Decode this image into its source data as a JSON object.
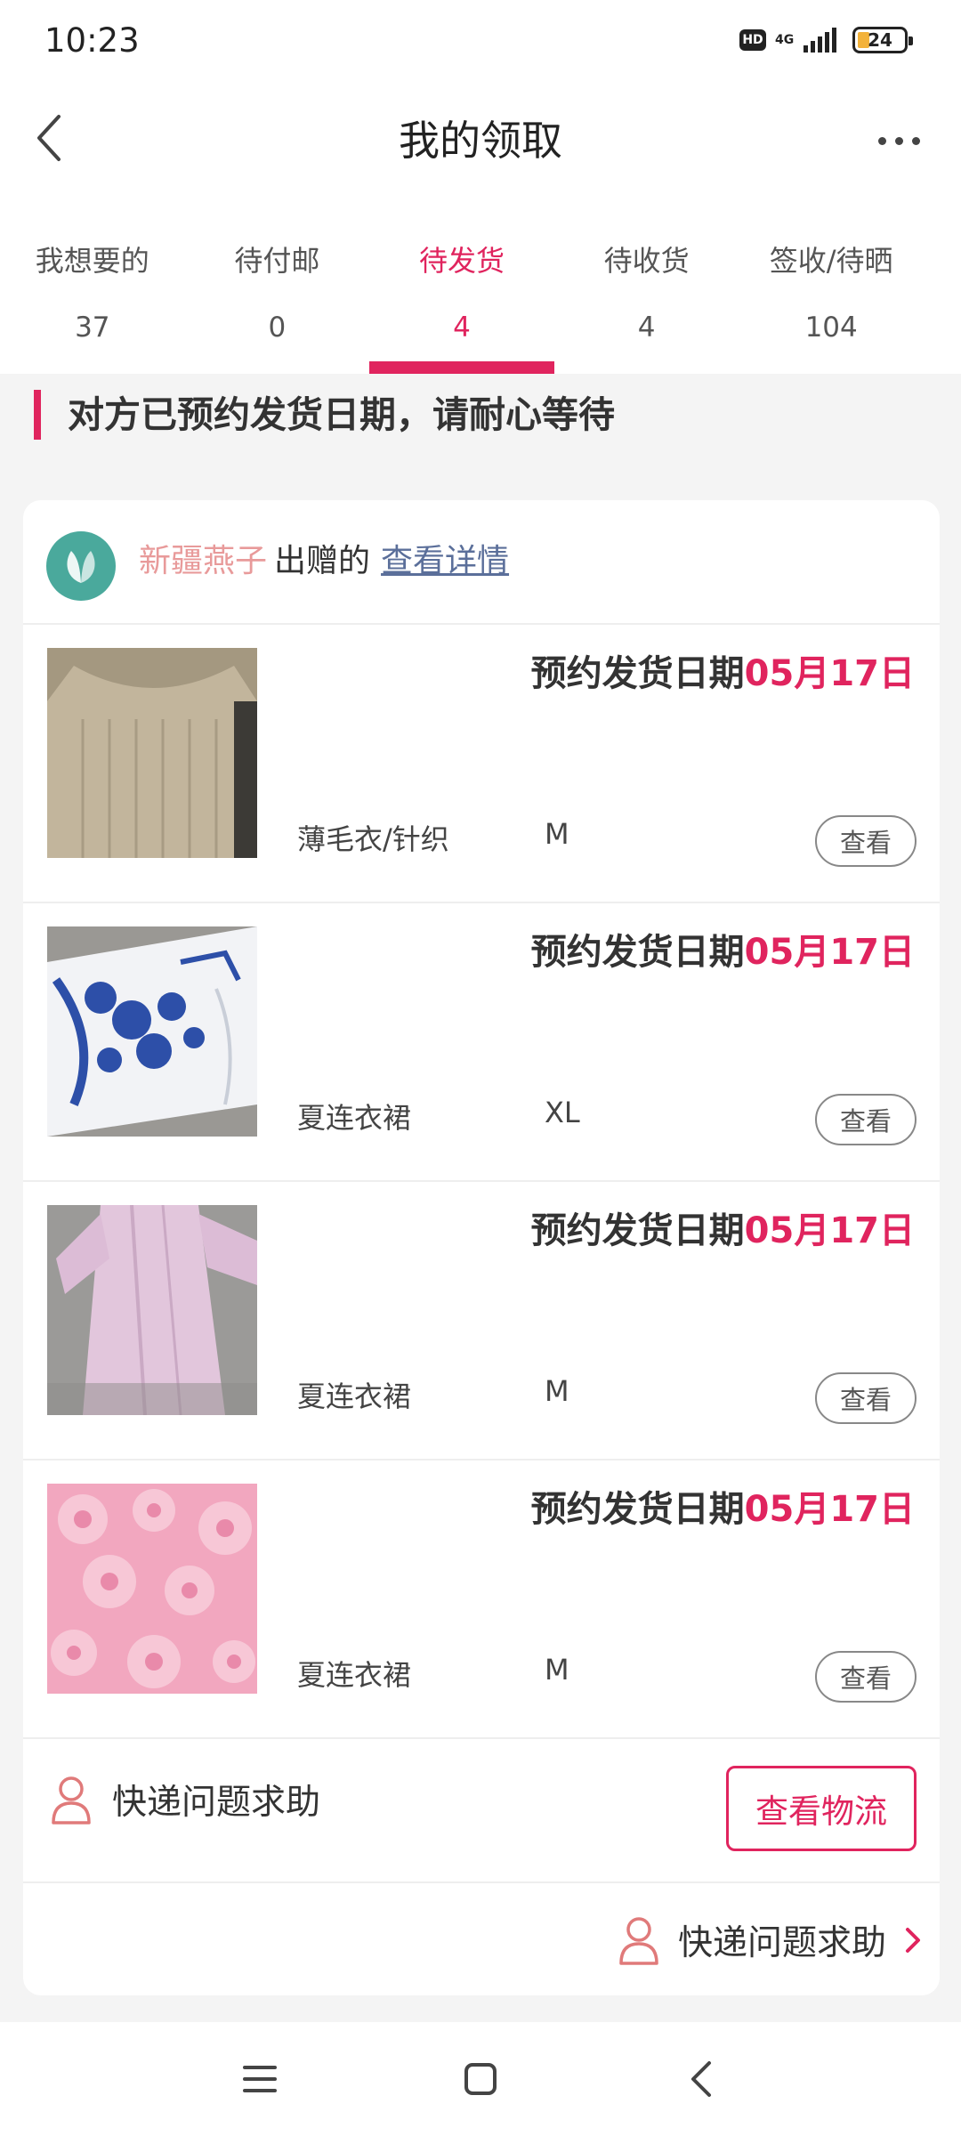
{
  "status_bar": {
    "time": "10:23",
    "hd": "HD",
    "network": "4G",
    "battery": "24"
  },
  "header": {
    "title": "我的领取"
  },
  "tabs": [
    {
      "label": "我想要的",
      "count": "37"
    },
    {
      "label": "待付邮",
      "count": "0"
    },
    {
      "label": "待发货",
      "count": "4"
    },
    {
      "label": "待收货",
      "count": "4"
    },
    {
      "label": "签收/待晒",
      "count": "104"
    }
  ],
  "active_tab": "待发货",
  "notice": "对方已预约发货日期，请耐心等待",
  "giver": {
    "name": "新疆燕子",
    "suffix": "出赠的",
    "link": "查看详情"
  },
  "items": [
    {
      "date_label": "预约发货日期",
      "date": "05月17日",
      "category": "薄毛衣/针织",
      "size": "M",
      "view_label": "查看"
    },
    {
      "date_label": "预约发货日期",
      "date": "05月17日",
      "category": "夏连衣裙",
      "size": "XL",
      "view_label": "查看"
    },
    {
      "date_label": "预约发货日期",
      "date": "05月17日",
      "category": "夏连衣裙",
      "size": "M",
      "view_label": "查看"
    },
    {
      "date_label": "预约发货日期",
      "date": "05月17日",
      "category": "夏连衣裙",
      "size": "M",
      "view_label": "查看"
    }
  ],
  "help": {
    "label": "快递问题求助",
    "logistics_button": "查看物流"
  },
  "help_link": {
    "label": "快递问题求助"
  },
  "colors": {
    "accent": "#e0245e",
    "giver_name": "#e89a9a",
    "link": "#5b6f9a",
    "avatar": "#4aa99c"
  },
  "icons": [
    "chevron-left-icon",
    "more-icon",
    "leaf-avatar-icon",
    "person-icon",
    "chevron-right-icon",
    "menu-icon",
    "home-icon",
    "back-icon"
  ]
}
